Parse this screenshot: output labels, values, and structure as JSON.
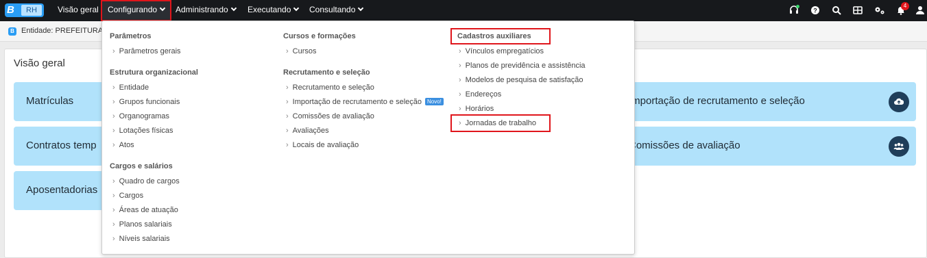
{
  "brand": {
    "logo_letter": "B",
    "module": "RH"
  },
  "nav": {
    "items": [
      "Visão geral",
      "Configurando",
      "Administrando",
      "Executando",
      "Consultando"
    ]
  },
  "notifications": {
    "count": "4"
  },
  "entity": {
    "text": "Entidade: PREFEITURA D"
  },
  "main": {
    "title": "Visão geral",
    "cards_left": [
      "Matrículas",
      "Contratos temp",
      "Aposentadorias"
    ],
    "cards_right": [
      "Importação de recrutamento e seleção",
      "Comissões de avaliação"
    ]
  },
  "menu": {
    "col1": {
      "s1_title": "Parâmetros",
      "s1_links": [
        "Parâmetros gerais"
      ],
      "s2_title": "Estrutura organizacional",
      "s2_links": [
        "Entidade",
        "Grupos funcionais",
        "Organogramas",
        "Lotações físicas",
        "Atos"
      ],
      "s3_title": "Cargos e salários",
      "s3_links": [
        "Quadro de cargos",
        "Cargos",
        "Áreas de atuação",
        "Planos salariais",
        "Níveis salariais"
      ]
    },
    "col2": {
      "s1_title": "Cursos e formações",
      "s1_links": [
        "Cursos"
      ],
      "s2_title": "Recrutamento e seleção",
      "s2_links": [
        "Recrutamento e seleção",
        "Importação de recrutamento e seleção",
        "Comissões de avaliação",
        "Avaliações",
        "Locais de avaliação"
      ],
      "novo_badge": "Novo!"
    },
    "col3": {
      "s1_title": "Cadastros auxiliares",
      "s1_links": [
        "Vínculos empregatícios",
        "Planos de previdência e assistência",
        "Modelos de pesquisa de satisfação",
        "Endereços",
        "Horários",
        "Jornadas de trabalho"
      ]
    }
  },
  "colors": {
    "topbar": "#17191c",
    "highlight": "#e0151b",
    "card": "#b1e2fb",
    "accent": "#2a9df4"
  }
}
